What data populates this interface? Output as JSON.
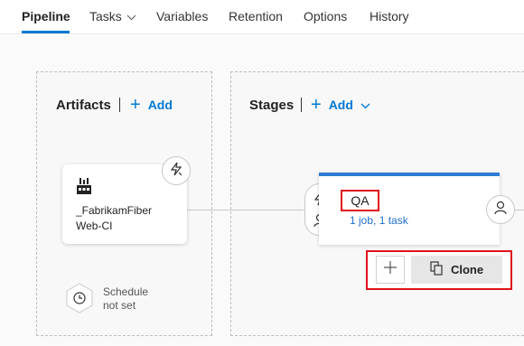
{
  "tabs": [
    {
      "label": "Pipeline",
      "active": true
    },
    {
      "label": "Tasks",
      "has_dropdown": true
    },
    {
      "label": "Variables"
    },
    {
      "label": "Retention"
    },
    {
      "label": "Options"
    },
    {
      "label": "History"
    }
  ],
  "artifacts": {
    "title": "Artifacts",
    "add_label": "Add",
    "card": {
      "name_line1": "_FabrikamFiber",
      "name_line2": "Web-CI",
      "icon": "build-icon",
      "trigger_icon": "lightning-icon"
    },
    "schedule": {
      "icon": "clock-icon",
      "line1": "Schedule",
      "line2": "not set"
    }
  },
  "stages": {
    "title": "Stages",
    "add_label": "Add",
    "stage": {
      "name": "QA",
      "subtitle": "1 job, 1 task",
      "accent_color": "#2e7bd6"
    },
    "clone_label": "Clone"
  },
  "colors": {
    "accent": "#0078d4",
    "highlight": "#e0121c"
  }
}
